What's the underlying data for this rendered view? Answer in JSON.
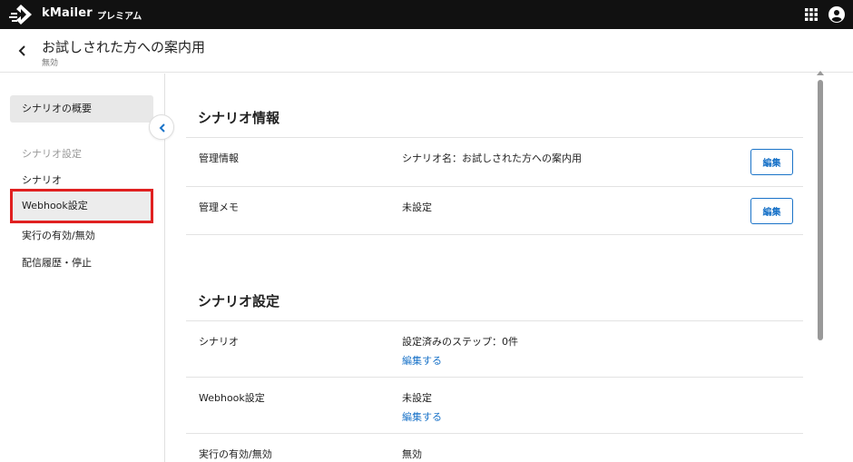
{
  "topbar": {
    "brand": "kMailer",
    "plan": "プレミアム",
    "icons": [
      "logo-icon",
      "apps-grid-icon",
      "account-circle-icon"
    ]
  },
  "header": {
    "title": "お試しされた方への案内用",
    "status": "無効"
  },
  "sidebar": {
    "overview": "シナリオの概要",
    "section_label": "シナリオ設定",
    "items": [
      "シナリオ",
      "Webhook設定",
      "実行の有効/無効",
      "配信履歴・停止"
    ]
  },
  "scenario_info": {
    "title": "シナリオ情報",
    "rows": [
      {
        "label": "管理情報",
        "value": "シナリオ名：お試しされた方への案内用",
        "button": "編集"
      },
      {
        "label": "管理メモ",
        "value": "未設定",
        "button": "編集"
      }
    ]
  },
  "scenario_settings": {
    "title": "シナリオ設定",
    "rows": [
      {
        "label": "シナリオ",
        "value": "設定済みのステップ：0件",
        "link": "編集する"
      },
      {
        "label": "Webhook設定",
        "value": "未設定",
        "link": "編集する"
      },
      {
        "label": "実行の有効/無効",
        "value": "無効"
      }
    ]
  },
  "colors": {
    "topbar": "#111111",
    "accent": "#1a73c8",
    "highlight_border": "#e02020"
  }
}
